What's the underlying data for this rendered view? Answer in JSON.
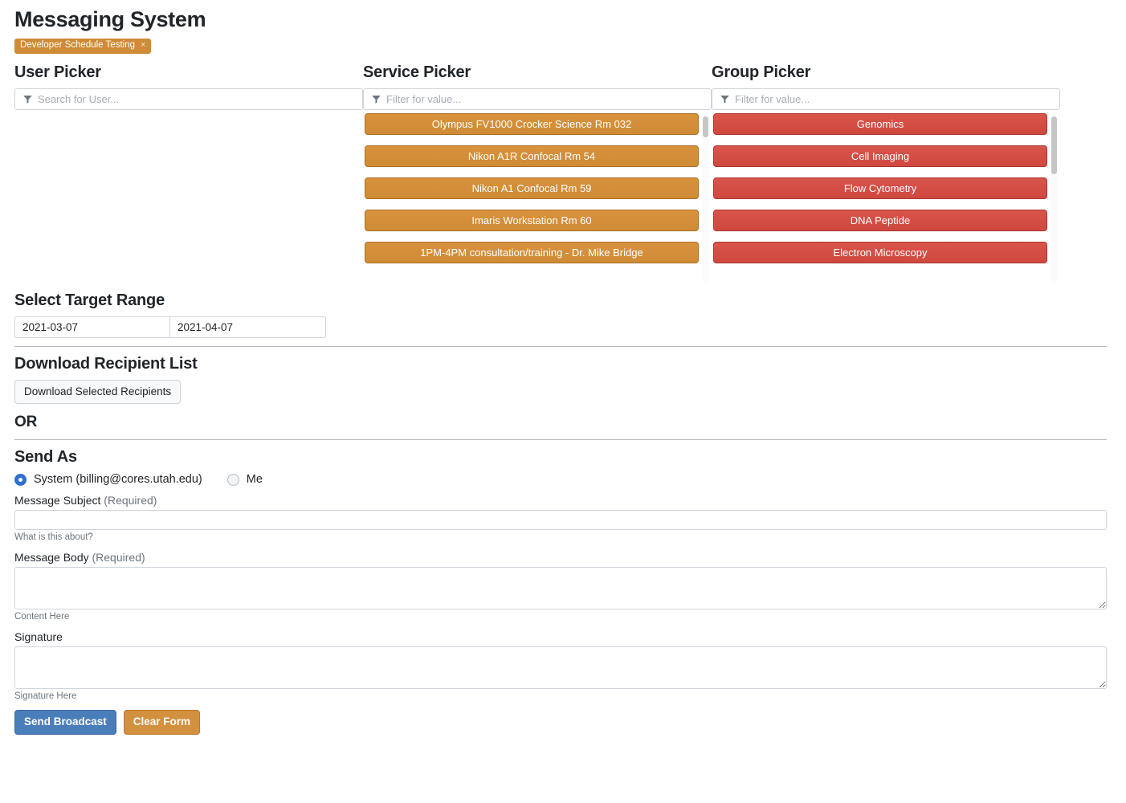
{
  "header": {
    "title": "Messaging System",
    "tag": {
      "label": "Developer Schedule Testing",
      "close": "×"
    }
  },
  "pickers": {
    "user": {
      "title": "User Picker",
      "filter_placeholder": "Search for User...",
      "filter_value": "",
      "icon": "filter-funnel-icon",
      "items": []
    },
    "service": {
      "title": "Service Picker",
      "filter_placeholder": "Filter for value...",
      "filter_value": "",
      "icon": "filter-funnel-icon",
      "color": "#cf8b36",
      "items": [
        "Olympus FV1000 Crocker Science Rm 032",
        "Nikon A1R Confocal Rm 54",
        "Nikon A1 Confocal Rm 59",
        "Imaris Workstation Rm 60",
        "1PM-4PM consultation/training - Dr. Mike Bridge"
      ]
    },
    "group": {
      "title": "Group Picker",
      "filter_placeholder": "Filter for value...",
      "filter_value": "",
      "icon": "filter-funnel-icon",
      "color": "#cf4840",
      "items": [
        "Genomics",
        "Cell Imaging",
        "Flow Cytometry",
        "DNA Peptide",
        "Electron Microscopy"
      ]
    }
  },
  "target_range": {
    "title": "Select Target Range",
    "start_date": "2021-03-07",
    "end_date": "2021-04-07"
  },
  "download": {
    "title": "Download Recipient List",
    "button_label": "Download Selected Recipients"
  },
  "or_label": "OR",
  "send_as": {
    "title": "Send As",
    "options": [
      {
        "label": "System (billing@cores.utah.edu)",
        "selected": true
      },
      {
        "label": "Me",
        "selected": false
      }
    ]
  },
  "form": {
    "subject": {
      "label": "Message Subject",
      "required_note": "(Required)",
      "value": "",
      "help": "What is this about?"
    },
    "body": {
      "label": "Message Body",
      "required_note": "(Required)",
      "value": "",
      "help": "Content Here"
    },
    "signature": {
      "label": "Signature",
      "value": "",
      "help": "Signature Here"
    }
  },
  "actions": {
    "send_label": "Send Broadcast",
    "clear_label": "Clear Form"
  }
}
